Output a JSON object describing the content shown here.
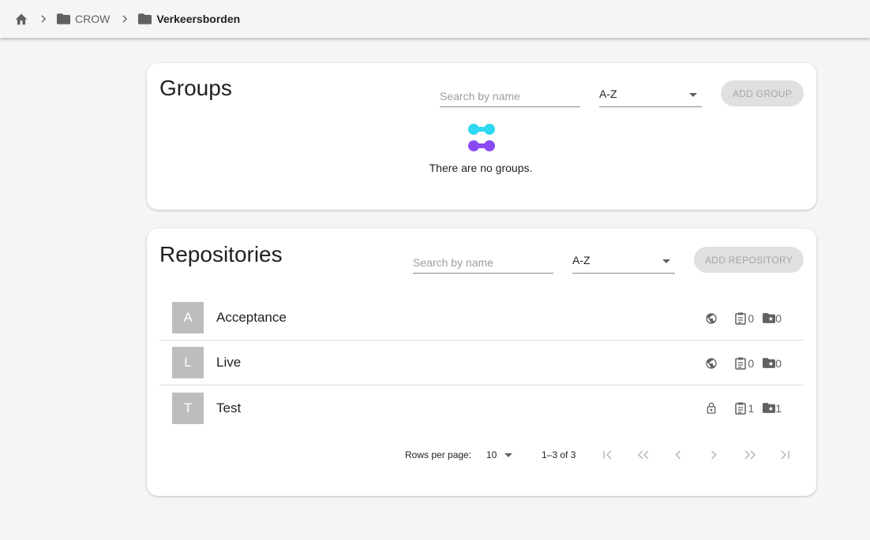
{
  "breadcrumb": {
    "home_icon": "home-icon",
    "items": [
      {
        "label": "CROW",
        "icon": "folder-icon"
      },
      {
        "label": "Verkeersborden",
        "icon": "folder-icon"
      }
    ],
    "separator_icon": "chevron-right-icon"
  },
  "groups": {
    "title": "Groups",
    "search_placeholder": "Search by name",
    "sort_value": "A-Z",
    "add_label": "ADD GROUP",
    "empty_text": "There are no groups.",
    "empty_icon": "empty-groups-icon"
  },
  "repositories": {
    "title": "Repositories",
    "search_placeholder": "Search by name",
    "sort_value": "A-Z",
    "add_label": "ADD REPOSITORY",
    "items": [
      {
        "initial": "A",
        "name": "Acceptance",
        "visibility_icon": "globe-icon",
        "datasets": "0",
        "stories": "0"
      },
      {
        "initial": "L",
        "name": "Live",
        "visibility_icon": "globe-icon",
        "datasets": "0",
        "stories": "0"
      },
      {
        "initial": "T",
        "name": "Test",
        "visibility_icon": "lock-icon",
        "datasets": "1",
        "stories": "1"
      }
    ],
    "pagination": {
      "rows_per_page_label": "Rows per page:",
      "rows_per_page": "10",
      "range": "1–3 of 3"
    }
  },
  "colors": {
    "avatar": "#bdbdbd",
    "button_disabled": "#e0e0e0",
    "accent_cyan": "#2ed8f2",
    "accent_purple": "#8a4af3"
  }
}
